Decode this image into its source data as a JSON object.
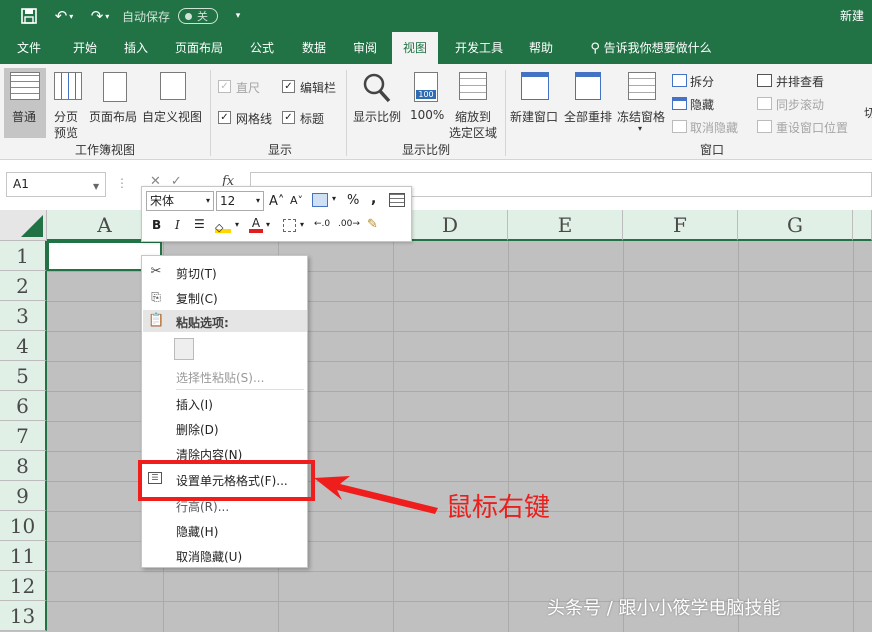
{
  "titlebar": {
    "autosave_label": "自动保存",
    "autosave_state": "关",
    "doc_title": "新建"
  },
  "tabs": [
    "文件",
    "开始",
    "插入",
    "页面布局",
    "公式",
    "数据",
    "审阅",
    "视图",
    "开发工具",
    "帮助"
  ],
  "active_tab": "视图",
  "tell_me": "告诉我你想要做什么",
  "ribbon": {
    "workbook_views": {
      "group_label": "工作簿视图",
      "normal": "普通",
      "page_break_1": "分页",
      "page_break_2": "预览",
      "page_layout": "页面布局",
      "custom_views": "自定义视图"
    },
    "show": {
      "group_label": "显示",
      "ruler": "直尺",
      "formula_bar": "编辑栏",
      "gridlines": "网格线",
      "headings": "标题"
    },
    "zoom": {
      "group_label": "显示比例",
      "zoom": "显示比例",
      "hundred": "100%",
      "zoom_sel_1": "缩放到",
      "zoom_sel_2": "选定区域",
      "icon_100": "100"
    },
    "window": {
      "group_label": "窗口",
      "new_window": "新建窗口",
      "arrange_all": "全部重排",
      "freeze_panes": "冻结窗格",
      "split": "拆分",
      "hide": "隐藏",
      "unhide": "取消隐藏",
      "view_side": "并排查看",
      "sync_scroll": "同步滚动",
      "reset_pos": "重设窗口位置",
      "switch_cut": "切"
    }
  },
  "formula_bar": {
    "name_box": "A1",
    "fx": "fx"
  },
  "grid": {
    "columns": [
      "A",
      "B",
      "C",
      "D",
      "E",
      "F",
      "G"
    ],
    "rows": [
      "1",
      "2",
      "3",
      "4",
      "5",
      "6",
      "7",
      "8",
      "9",
      "10",
      "11",
      "12",
      "13"
    ]
  },
  "mini_toolbar": {
    "font": "宋体",
    "size": "12",
    "bold": "B",
    "italic": "I",
    "percent": "%",
    "comma": ","
  },
  "context_menu": {
    "cut": "剪切(T)",
    "copy": "复制(C)",
    "paste_options": "粘贴选项:",
    "paste_special": "选择性粘贴(S)...",
    "insert": "插入(I)",
    "delete": "删除(D)",
    "clear": "清除内容(N)",
    "format_cells": "设置单元格格式(F)...",
    "column_width": "行高(R)...",
    "hide": "隐藏(H)",
    "unhide": "取消隐藏(U)"
  },
  "annotation": "鼠标右键",
  "watermark": "头条号 / 跟小小筱学电脑技能",
  "colors": {
    "excel_green": "#217346",
    "highlight_red": "#f01d1d",
    "grid_fill": "#c0c0c0"
  }
}
